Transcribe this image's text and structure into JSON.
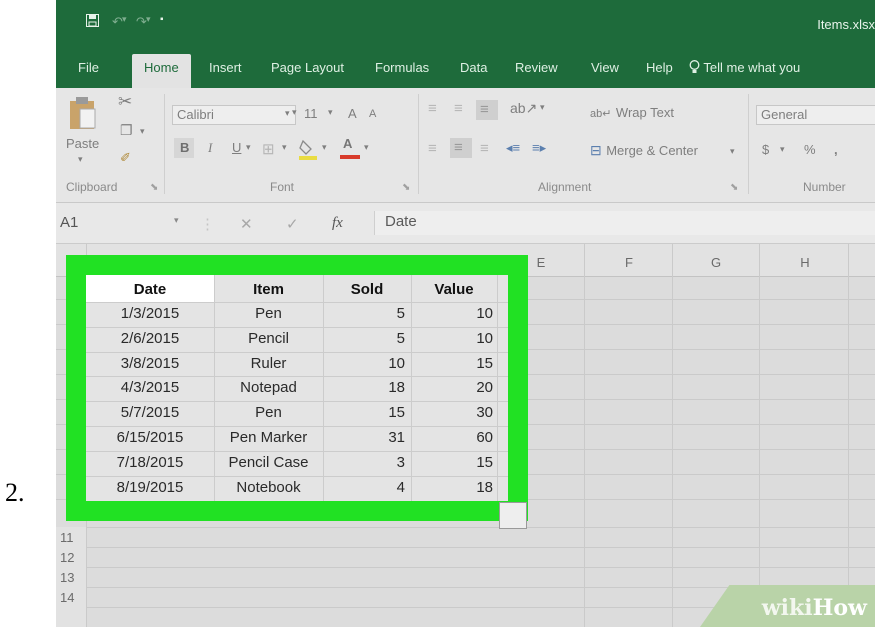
{
  "step_number": "2.",
  "titlebar": {
    "filename": "Items.xlsx",
    "icons": [
      "save-icon",
      "undo-icon",
      "redo-icon",
      "customize-quick-access-icon"
    ]
  },
  "tabs": [
    "File",
    "Home",
    "Insert",
    "Page Layout",
    "Formulas",
    "Data",
    "Review",
    "View",
    "Help"
  ],
  "active_tab": "Home",
  "tell_me": "Tell me what you",
  "ribbon": {
    "paste_label": "Paste",
    "font_name": "Calibri",
    "font_size": "11",
    "grow_font": "A",
    "shrink_font": "A",
    "bold": "B",
    "italic": "I",
    "underline": "U",
    "font_color": "A",
    "wrap_text": "Wrap Text",
    "merge_center": "Merge & Center",
    "number_format": "General",
    "currency": "$",
    "percent": "%",
    "comma": ",",
    "groups": {
      "clipboard": "Clipboard",
      "font": "Font",
      "alignment": "Alignment",
      "number": "Number"
    }
  },
  "formula_bar": {
    "name_box": "A1",
    "cancel": "✕",
    "enter": "✓",
    "fx": "fx",
    "content": "Date"
  },
  "columns": [
    "E",
    "F",
    "G",
    "H"
  ],
  "rows_visible": [
    "11",
    "12",
    "13",
    "14"
  ],
  "table": {
    "headers": [
      "Date",
      "Item",
      "Sold",
      "Value"
    ],
    "rows": [
      [
        "1/3/2015",
        "Pen",
        "5",
        "10"
      ],
      [
        "2/6/2015",
        "Pencil",
        "5",
        "10"
      ],
      [
        "3/8/2015",
        "Ruler",
        "10",
        "15"
      ],
      [
        "4/3/2015",
        "Notepad",
        "18",
        "20"
      ],
      [
        "5/7/2015",
        "Pen",
        "15",
        "30"
      ],
      [
        "6/15/2015",
        "Pen Marker",
        "31",
        "60"
      ],
      [
        "7/18/2015",
        "Pencil Case",
        "3",
        "15"
      ],
      [
        "8/19/2015",
        "Notebook",
        "4",
        "18"
      ]
    ]
  },
  "watermark": {
    "part1": "wiki",
    "part2": "How"
  },
  "colors": {
    "excel_green": "#1e6b3b",
    "highlight_green": "#21e123"
  }
}
